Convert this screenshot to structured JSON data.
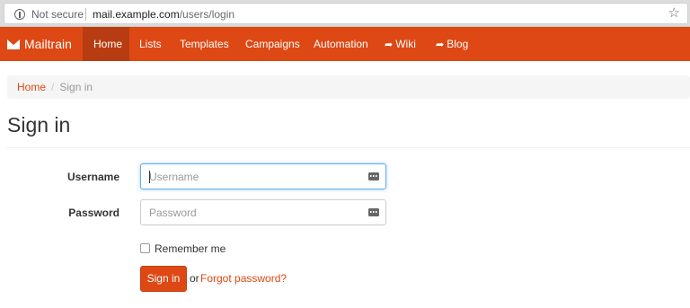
{
  "browser": {
    "security_label": "Not secure",
    "url_host": "mail.example.com",
    "url_path": "/users/login"
  },
  "nav": {
    "brand": "Mailtrain",
    "items": [
      {
        "label": "Home",
        "active": true
      },
      {
        "label": "Lists"
      },
      {
        "label": "Templates"
      },
      {
        "label": "Campaigns"
      },
      {
        "label": "Automation"
      },
      {
        "label": "Wiki",
        "icon": "share-arrow-icon"
      },
      {
        "label": "Blog",
        "icon": "share-arrow-icon"
      }
    ],
    "accent_color": "#dd4814"
  },
  "breadcrumb": {
    "home": "Home",
    "separator": "/",
    "current": "Sign in"
  },
  "page": {
    "title": "Sign in"
  },
  "form": {
    "username": {
      "label": "Username",
      "placeholder": "Username",
      "value": ""
    },
    "password": {
      "label": "Password",
      "placeholder": "Password",
      "value": ""
    },
    "remember_label": "Remember me",
    "remember_checked": false,
    "submit_label": "Sign in",
    "or_text": "or",
    "forgot_label": "Forgot password?"
  }
}
